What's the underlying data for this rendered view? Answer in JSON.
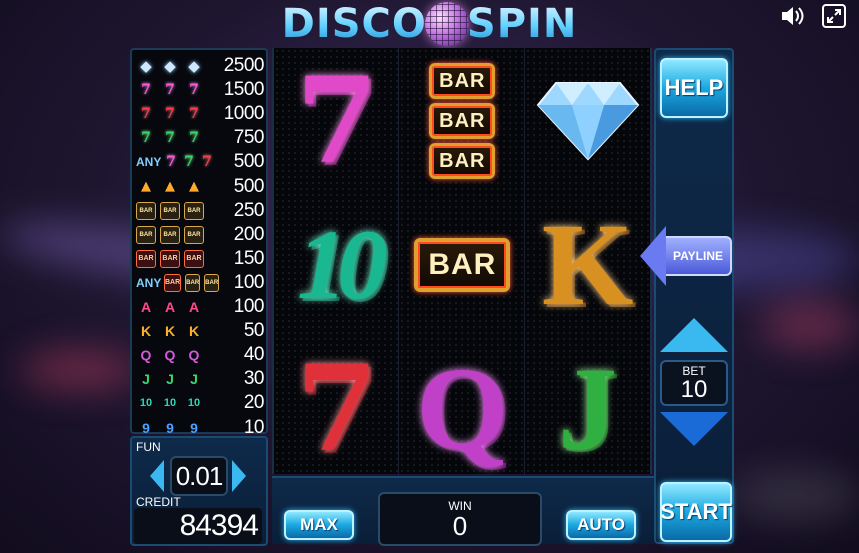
{
  "title": {
    "left": "DISCO",
    "right": "SPIN"
  },
  "icons": {
    "sound": "speaker-icon",
    "fullscreen": "fullscreen-icon"
  },
  "paytable": [
    {
      "any": "",
      "symbols": [
        "diamond",
        "diamond",
        "diamond"
      ],
      "payout": "2500"
    },
    {
      "any": "",
      "symbols": [
        "7-pink",
        "7-pink",
        "7-pink"
      ],
      "payout": "1500"
    },
    {
      "any": "",
      "symbols": [
        "7-red",
        "7-red",
        "7-red"
      ],
      "payout": "1000"
    },
    {
      "any": "",
      "symbols": [
        "7-green",
        "7-green",
        "7-green"
      ],
      "payout": "750"
    },
    {
      "any": "ANY",
      "symbols": [
        "7-pink",
        "7-green",
        "7-red"
      ],
      "payout": "500"
    },
    {
      "any": "",
      "symbols": [
        "bell",
        "bell",
        "bell"
      ],
      "payout": "500"
    },
    {
      "any": "",
      "symbols": [
        "bar3",
        "bar3",
        "bar3"
      ],
      "payout": "250"
    },
    {
      "any": "",
      "symbols": [
        "bar2",
        "bar2",
        "bar2"
      ],
      "payout": "200"
    },
    {
      "any": "",
      "symbols": [
        "bar1",
        "bar1",
        "bar1"
      ],
      "payout": "150"
    },
    {
      "any": "ANY",
      "symbols": [
        "bar1",
        "bar2",
        "bar3"
      ],
      "payout": "100"
    },
    {
      "any": "",
      "symbols": [
        "A",
        "A",
        "A"
      ],
      "payout": "100"
    },
    {
      "any": "",
      "symbols": [
        "K",
        "K",
        "K"
      ],
      "payout": "50"
    },
    {
      "any": "",
      "symbols": [
        "Q",
        "Q",
        "Q"
      ],
      "payout": "40"
    },
    {
      "any": "",
      "symbols": [
        "J",
        "J",
        "J"
      ],
      "payout": "30"
    },
    {
      "any": "",
      "symbols": [
        "10",
        "10",
        "10"
      ],
      "payout": "20"
    },
    {
      "any": "",
      "symbols": [
        "9",
        "9",
        "9"
      ],
      "payout": "10"
    }
  ],
  "reels": [
    [
      "7-pink",
      "10",
      "7-red"
    ],
    [
      "bar3",
      "bar1",
      "Q"
    ],
    [
      "diamond",
      "K",
      "J"
    ]
  ],
  "symbol_text": {
    "bar": "BAR",
    "seven": "7",
    "ten": "10",
    "Q": "Q",
    "K": "K",
    "J": "J"
  },
  "buttons": {
    "help": "HELP",
    "payline": "PAYLINE",
    "start": "START",
    "max": "MAX",
    "auto": "AUTO"
  },
  "bet": {
    "label": "BET",
    "value": "10"
  },
  "win": {
    "label": "WIN",
    "value": "0"
  },
  "coin": {
    "label": "FUN",
    "value": "0.01"
  },
  "credit": {
    "label": "CREDIT",
    "value": "84394"
  }
}
